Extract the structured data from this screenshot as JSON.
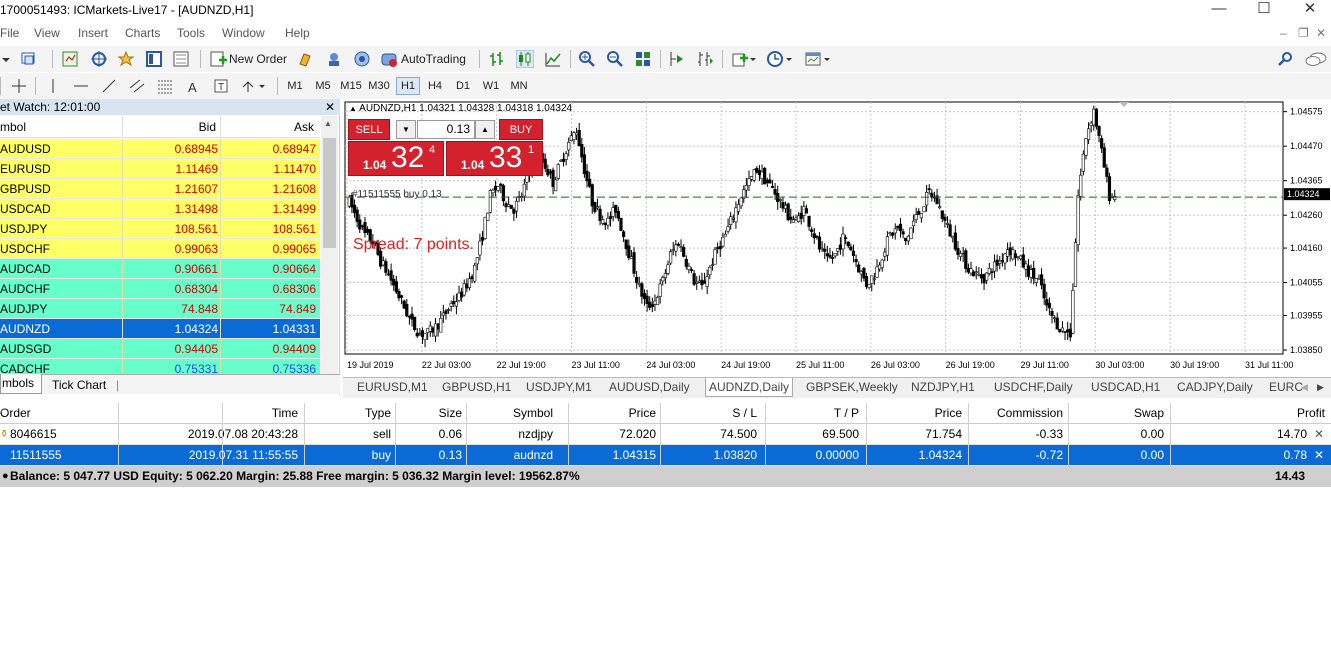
{
  "window": {
    "title": "1700051493: ICMarkets-Live17 - [AUDNZD,H1]",
    "minimize": "—",
    "maximize": "☐",
    "close": "✕"
  },
  "menu": [
    "File",
    "View",
    "Insert",
    "Charts",
    "Tools",
    "Window",
    "Help"
  ],
  "toolbar": {
    "new_order": "New Order",
    "autotrading": "AutoTrading"
  },
  "timeframes": [
    "M1",
    "M5",
    "M15",
    "M30",
    "H1",
    "H4",
    "D1",
    "W1",
    "MN"
  ],
  "timeframe_active": "H1",
  "market_watch": {
    "title": "et Watch: 12:01:00",
    "headers": {
      "symbol": "mbol",
      "bid": "Bid",
      "ask": "Ask"
    },
    "rows": [
      {
        "symbol": "AUDUSD",
        "bid": "0.68945",
        "ask": "0.68947",
        "bg": "#ffff66"
      },
      {
        "symbol": "EURUSD",
        "bid": "1.11469",
        "ask": "1.11470",
        "bg": "#ffff66"
      },
      {
        "symbol": "GBPUSD",
        "bid": "1.21607",
        "ask": "1.21608",
        "bg": "#ffff66"
      },
      {
        "symbol": "USDCAD",
        "bid": "1.31498",
        "ask": "1.31499",
        "bg": "#ffff66"
      },
      {
        "symbol": "USDJPY",
        "bid": "108.561",
        "ask": "108.561",
        "bg": "#ffff66"
      },
      {
        "symbol": "USDCHF",
        "bid": "0.99063",
        "ask": "0.99065",
        "bg": "#ffff66"
      },
      {
        "symbol": "AUDCAD",
        "bid": "0.90661",
        "ask": "0.90664",
        "bg": "#66ffcc"
      },
      {
        "symbol": "AUDCHF",
        "bid": "0.68304",
        "ask": "0.68306",
        "bg": "#66ffcc"
      },
      {
        "symbol": "AUDJPY",
        "bid": "74.848",
        "ask": "74.849",
        "bg": "#66ffcc"
      },
      {
        "symbol": "AUDNZD",
        "bid": "1.04324",
        "ask": "1.04331",
        "bg": "#0a6bd6"
      },
      {
        "symbol": "AUDSGD",
        "bid": "0.94405",
        "ask": "0.94409",
        "bg": "#66ffcc"
      },
      {
        "symbol": "CADCHF",
        "bid": "0.75331",
        "ask": "0.75336",
        "bg": "#66ffcc"
      }
    ],
    "tabs": [
      "mbols",
      "Tick Chart"
    ]
  },
  "chart": {
    "info": "AUDNZD,H1  1.04321 1.04328 1.04318 1.04324",
    "sell_label": "SELL",
    "buy_label": "BUY",
    "lot": "0.13",
    "sell_price_small": "1.04",
    "sell_price_big": "32",
    "sell_price_sup": "4",
    "buy_price_small": "1.04",
    "buy_price_big": "33",
    "buy_price_sup": "1",
    "order_line": "#11511555 buy 0.13",
    "spread": "Spread: 7 points.",
    "current_price": "1.04324",
    "tabs": [
      "EURUSD,M1",
      "GBPUSD,H1",
      "USDJPY,M1",
      "AUDUSD,Daily",
      "AUDNZD,Daily",
      "GBPSEK,Weekly",
      "NZDJPY,H1",
      "USDCHF,Daily",
      "USDCAD,H1",
      "CADJPY,Daily",
      "EURC"
    ]
  },
  "chart_data": {
    "type": "candlestick",
    "y_ticks": [
      "1.04575",
      "1.04470",
      "1.04365",
      "1.04260",
      "1.04160",
      "1.04055",
      "1.03955",
      "1.03850"
    ],
    "ylim": [
      1.0385,
      1.0458
    ],
    "x_ticks": [
      "19 Jul 2019",
      "22 Jul 03:00",
      "22 Jul 19:00",
      "23 Jul 11:00",
      "24 Jul 03:00",
      "24 Jul 19:00",
      "25 Jul 11:00",
      "26 Jul 03:00",
      "26 Jul 19:00",
      "29 Jul 11:00",
      "30 Jul 03:00",
      "30 Jul 19:00",
      "31 Jul 11:00"
    ],
    "order_price": 1.04315,
    "close_path": [
      1.043,
      1.0425,
      1.042,
      1.0418,
      1.0412,
      1.0408,
      1.0403,
      1.0398,
      1.0393,
      1.039,
      1.039,
      1.0392,
      1.0395,
      1.0399,
      1.0401,
      1.0405,
      1.041,
      1.042,
      1.0432,
      1.0435,
      1.043,
      1.0428,
      1.0432,
      1.044,
      1.0445,
      1.0441,
      1.0436,
      1.0442,
      1.0448,
      1.0452,
      1.044,
      1.043,
      1.0426,
      1.0424,
      1.0428,
      1.042,
      1.0412,
      1.0404,
      1.0398,
      1.04,
      1.0406,
      1.0414,
      1.0418,
      1.0412,
      1.0406,
      1.0404,
      1.041,
      1.0416,
      1.042,
      1.0426,
      1.0432,
      1.0436,
      1.044,
      1.0437,
      1.0434,
      1.043,
      1.0426,
      1.0424,
      1.0428,
      1.0422,
      1.0416,
      1.0412,
      1.0414,
      1.0419,
      1.0416,
      1.041,
      1.0405,
      1.0408,
      1.0414,
      1.042,
      1.0422,
      1.0418,
      1.0424,
      1.0428,
      1.0433,
      1.043,
      1.0424,
      1.0419,
      1.0414,
      1.041,
      1.0408,
      1.0407,
      1.041,
      1.0412,
      1.0416,
      1.0414,
      1.0411,
      1.0408,
      1.0406,
      1.0398,
      1.0394,
      1.0391,
      1.039,
      1.0432,
      1.045,
      1.0458,
      1.0445,
      1.0432,
      1.0432
    ]
  },
  "terminal": {
    "headers": [
      "Order",
      "Time",
      "Type",
      "Size",
      "Symbol",
      "Price",
      "S / L",
      "T / P",
      "Price",
      "Commission",
      "Swap",
      "Profit"
    ],
    "rows": [
      {
        "order": "8046615",
        "time": "2019.07.08 20:43:28",
        "type": "sell",
        "size": "0.06",
        "symbol": "nzdjpy",
        "price": "72.020",
        "sl": "74.500",
        "tp": "69.500",
        "cur": "71.754",
        "commission": "-0.33",
        "swap": "0.00",
        "profit": "14.70"
      },
      {
        "order": "11511555",
        "time": "2019.07.31 11:55:55",
        "type": "buy",
        "size": "0.13",
        "symbol": "audnzd",
        "price": "1.04315",
        "sl": "1.03820",
        "tp": "0.00000",
        "cur": "1.04324",
        "commission": "-0.72",
        "swap": "0.00",
        "profit": "0.78"
      }
    ],
    "balance_line": "Balance: 5 047.77 USD  Equity: 5 062.20  Margin: 25.88  Free margin: 5 036.32  Margin level: 19562.87%",
    "total_profit": "14.43"
  },
  "colors": {
    "sell": "#d3212d",
    "selected": "#0a6bd6",
    "yellow_row": "#ffff66",
    "green_row": "#66ffcc"
  }
}
